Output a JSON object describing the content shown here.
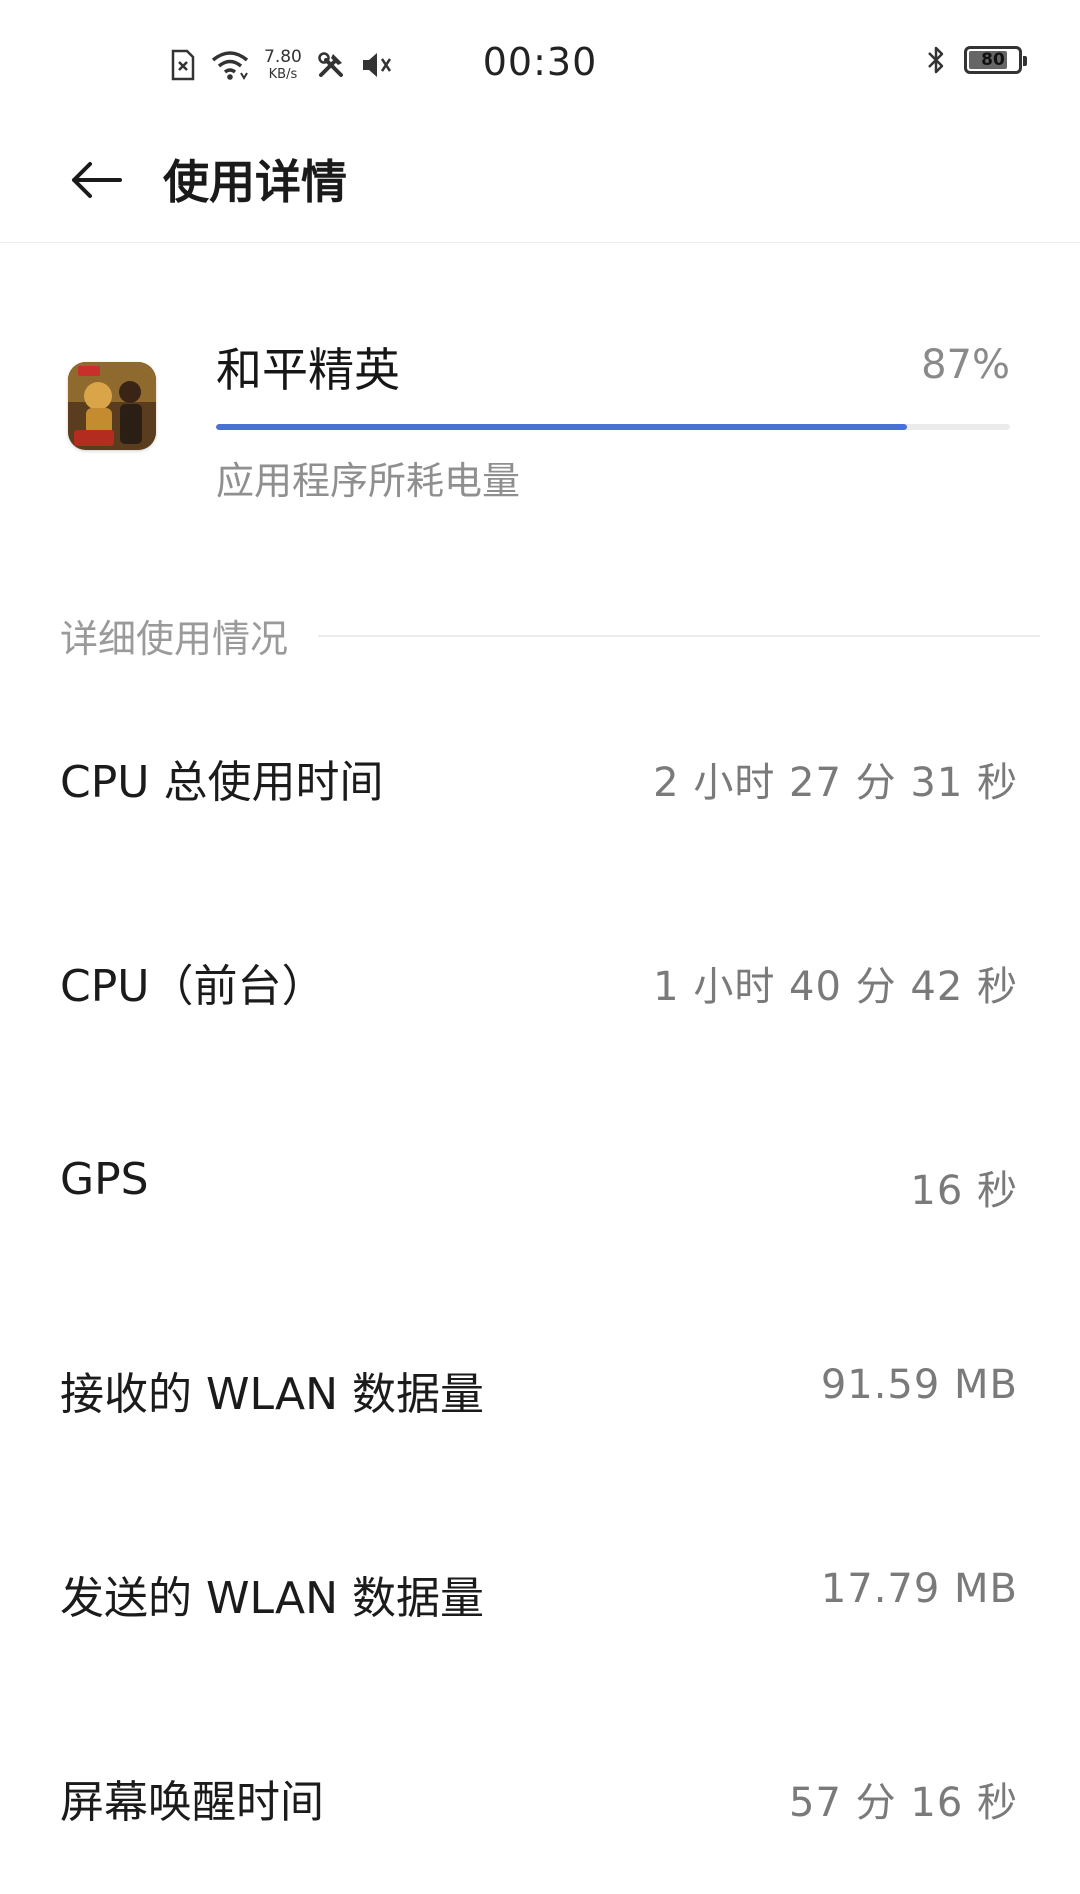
{
  "status_bar": {
    "net_speed_value": "7.80",
    "net_speed_unit": "KB/s",
    "time": "00:30",
    "battery_level": "80",
    "battery_fraction": 0.8,
    "icons": [
      "sim-error-icon",
      "wifi-icon",
      "tools-icon",
      "mute-icon",
      "bluetooth-icon",
      "battery-icon"
    ]
  },
  "header": {
    "back_icon": "arrow-left-icon",
    "title": "使用详情"
  },
  "app": {
    "name": "和平精英",
    "percent_label": "87%",
    "percent_value": 0.87,
    "subtitle": "应用程序所耗电量",
    "accent_color": "#4a72d4"
  },
  "section": {
    "title": "详细使用情况"
  },
  "rows": [
    {
      "label": "CPU 总使用时间",
      "value": "2 小时 27 分 31 秒"
    },
    {
      "label": "CPU（前台）",
      "value": "1 小时 40 分 42 秒"
    },
    {
      "label": "GPS",
      "value": "16 秒"
    },
    {
      "label": "接收的 WLAN 数据量",
      "value": "91.59 MB"
    },
    {
      "label": "发送的 WLAN 数据量",
      "value": "17.79 MB"
    },
    {
      "label": "屏幕唤醒时间",
      "value": "57 分 16 秒"
    }
  ]
}
